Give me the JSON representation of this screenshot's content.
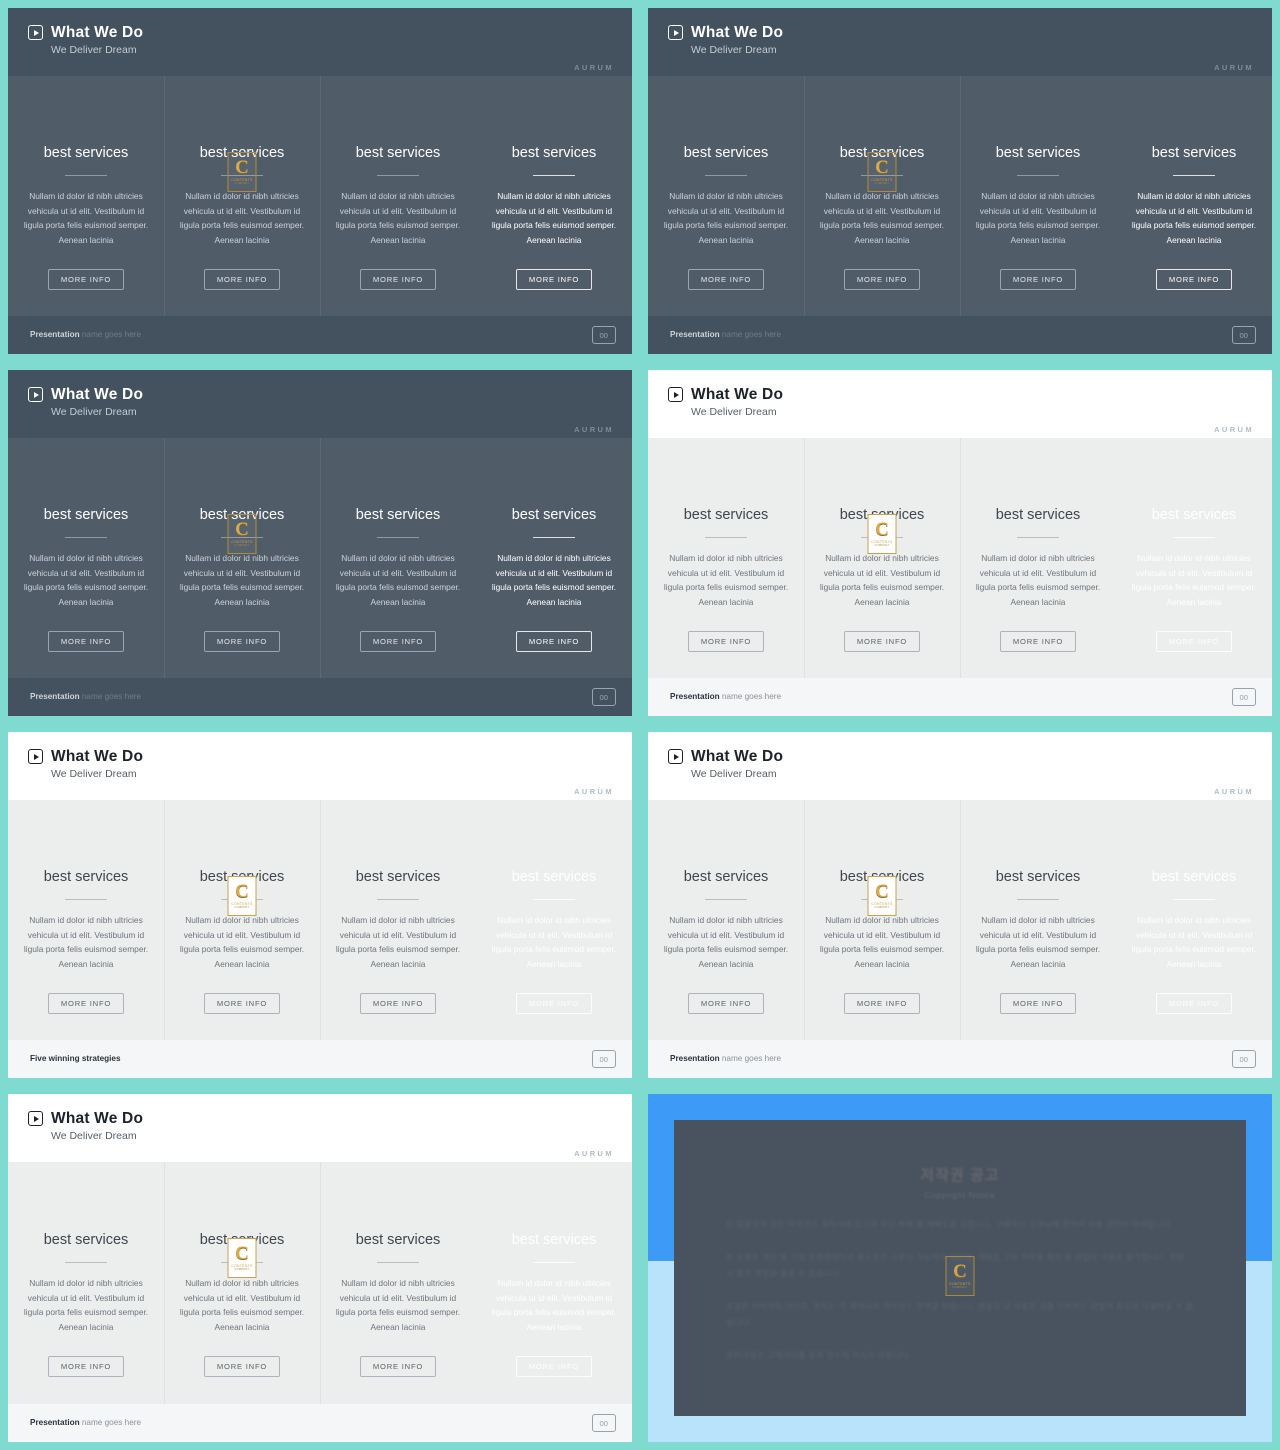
{
  "theme": {
    "page_background": "#7fdbd0",
    "dark_surface": "#44515e",
    "dark_column": "#505c68",
    "light_surface": "#ffffff",
    "light_column": "#eceded",
    "accent_red": "#f9495f",
    "accent_orange": "#f2972f",
    "accent_blue": "#3b9ee0",
    "accent_teal": "#2fd4bd",
    "accent_gold": "#d9ab4a",
    "notice_blue": "#3d9bf7"
  },
  "header": {
    "title": "What We Do",
    "subtitle": "We Deliver Dream",
    "brand": "AURUM",
    "play_icon": "play-icon"
  },
  "card": {
    "title": "best services",
    "body": "Nullam id dolor id nibh ultricies vehicula ut id elit. Vestibulum id ligula porta felis euismod semper. Aenean lacinia",
    "button": "MORE INFO"
  },
  "logo": {
    "letter": "C",
    "word1": "CONTENTS",
    "word2": "COMPANY"
  },
  "footer": {
    "label_bold": "Presentation",
    "label_rest": " name goes here",
    "alt_label_bold": "Five winning strategies",
    "alt_label_rest": "",
    "page": "00"
  },
  "slides": [
    {
      "id": "slide-1",
      "scheme": "dark",
      "accent": "acc-red",
      "footer": "default"
    },
    {
      "id": "slide-2",
      "scheme": "dark",
      "accent": "acc-muted",
      "footer": "default"
    },
    {
      "id": "slide-3",
      "scheme": "dark",
      "accent": "acc-orange",
      "footer": "default"
    },
    {
      "id": "slide-4",
      "scheme": "light",
      "accent": "acc-blue",
      "footer": "default"
    },
    {
      "id": "slide-5",
      "scheme": "light",
      "accent": "acc-red",
      "footer": "alt"
    },
    {
      "id": "slide-6",
      "scheme": "light",
      "accent": "acc-muted2",
      "footer": "default"
    },
    {
      "id": "slide-7",
      "scheme": "light",
      "accent": "acc-orange",
      "footer": "default"
    }
  ],
  "notice": {
    "title_ko": "저작권 공고",
    "title_en": "Copyright Notice",
    "para1": "본 템플릿의 모든 저작권은 제작사에 있으며 무단 복제 및 재배포를 금합니다. 구매하신 고객님께 한하여 사용 권한이 부여됩니다.",
    "para2": "본 상품은 개인 및 기업 프레젠테이션 용도로만 사용이 가능하며 재판매, 재배포, 2차 저작물 제작 등 상업적 이용은 불가합니다. 위반 시 법적 책임을 물을 수 있습니다.",
    "para3": "포함된 이미지와 아이콘, 폰트는 각 제작사의 라이선스 정책을 따릅니다. 템플릿 내 사용된 샘플 이미지는 상업적 용도로 사용하실 수 없습니다.",
    "para4": "문의사항은 고객센터를 통해 접수해 주시기 바랍니다."
  }
}
